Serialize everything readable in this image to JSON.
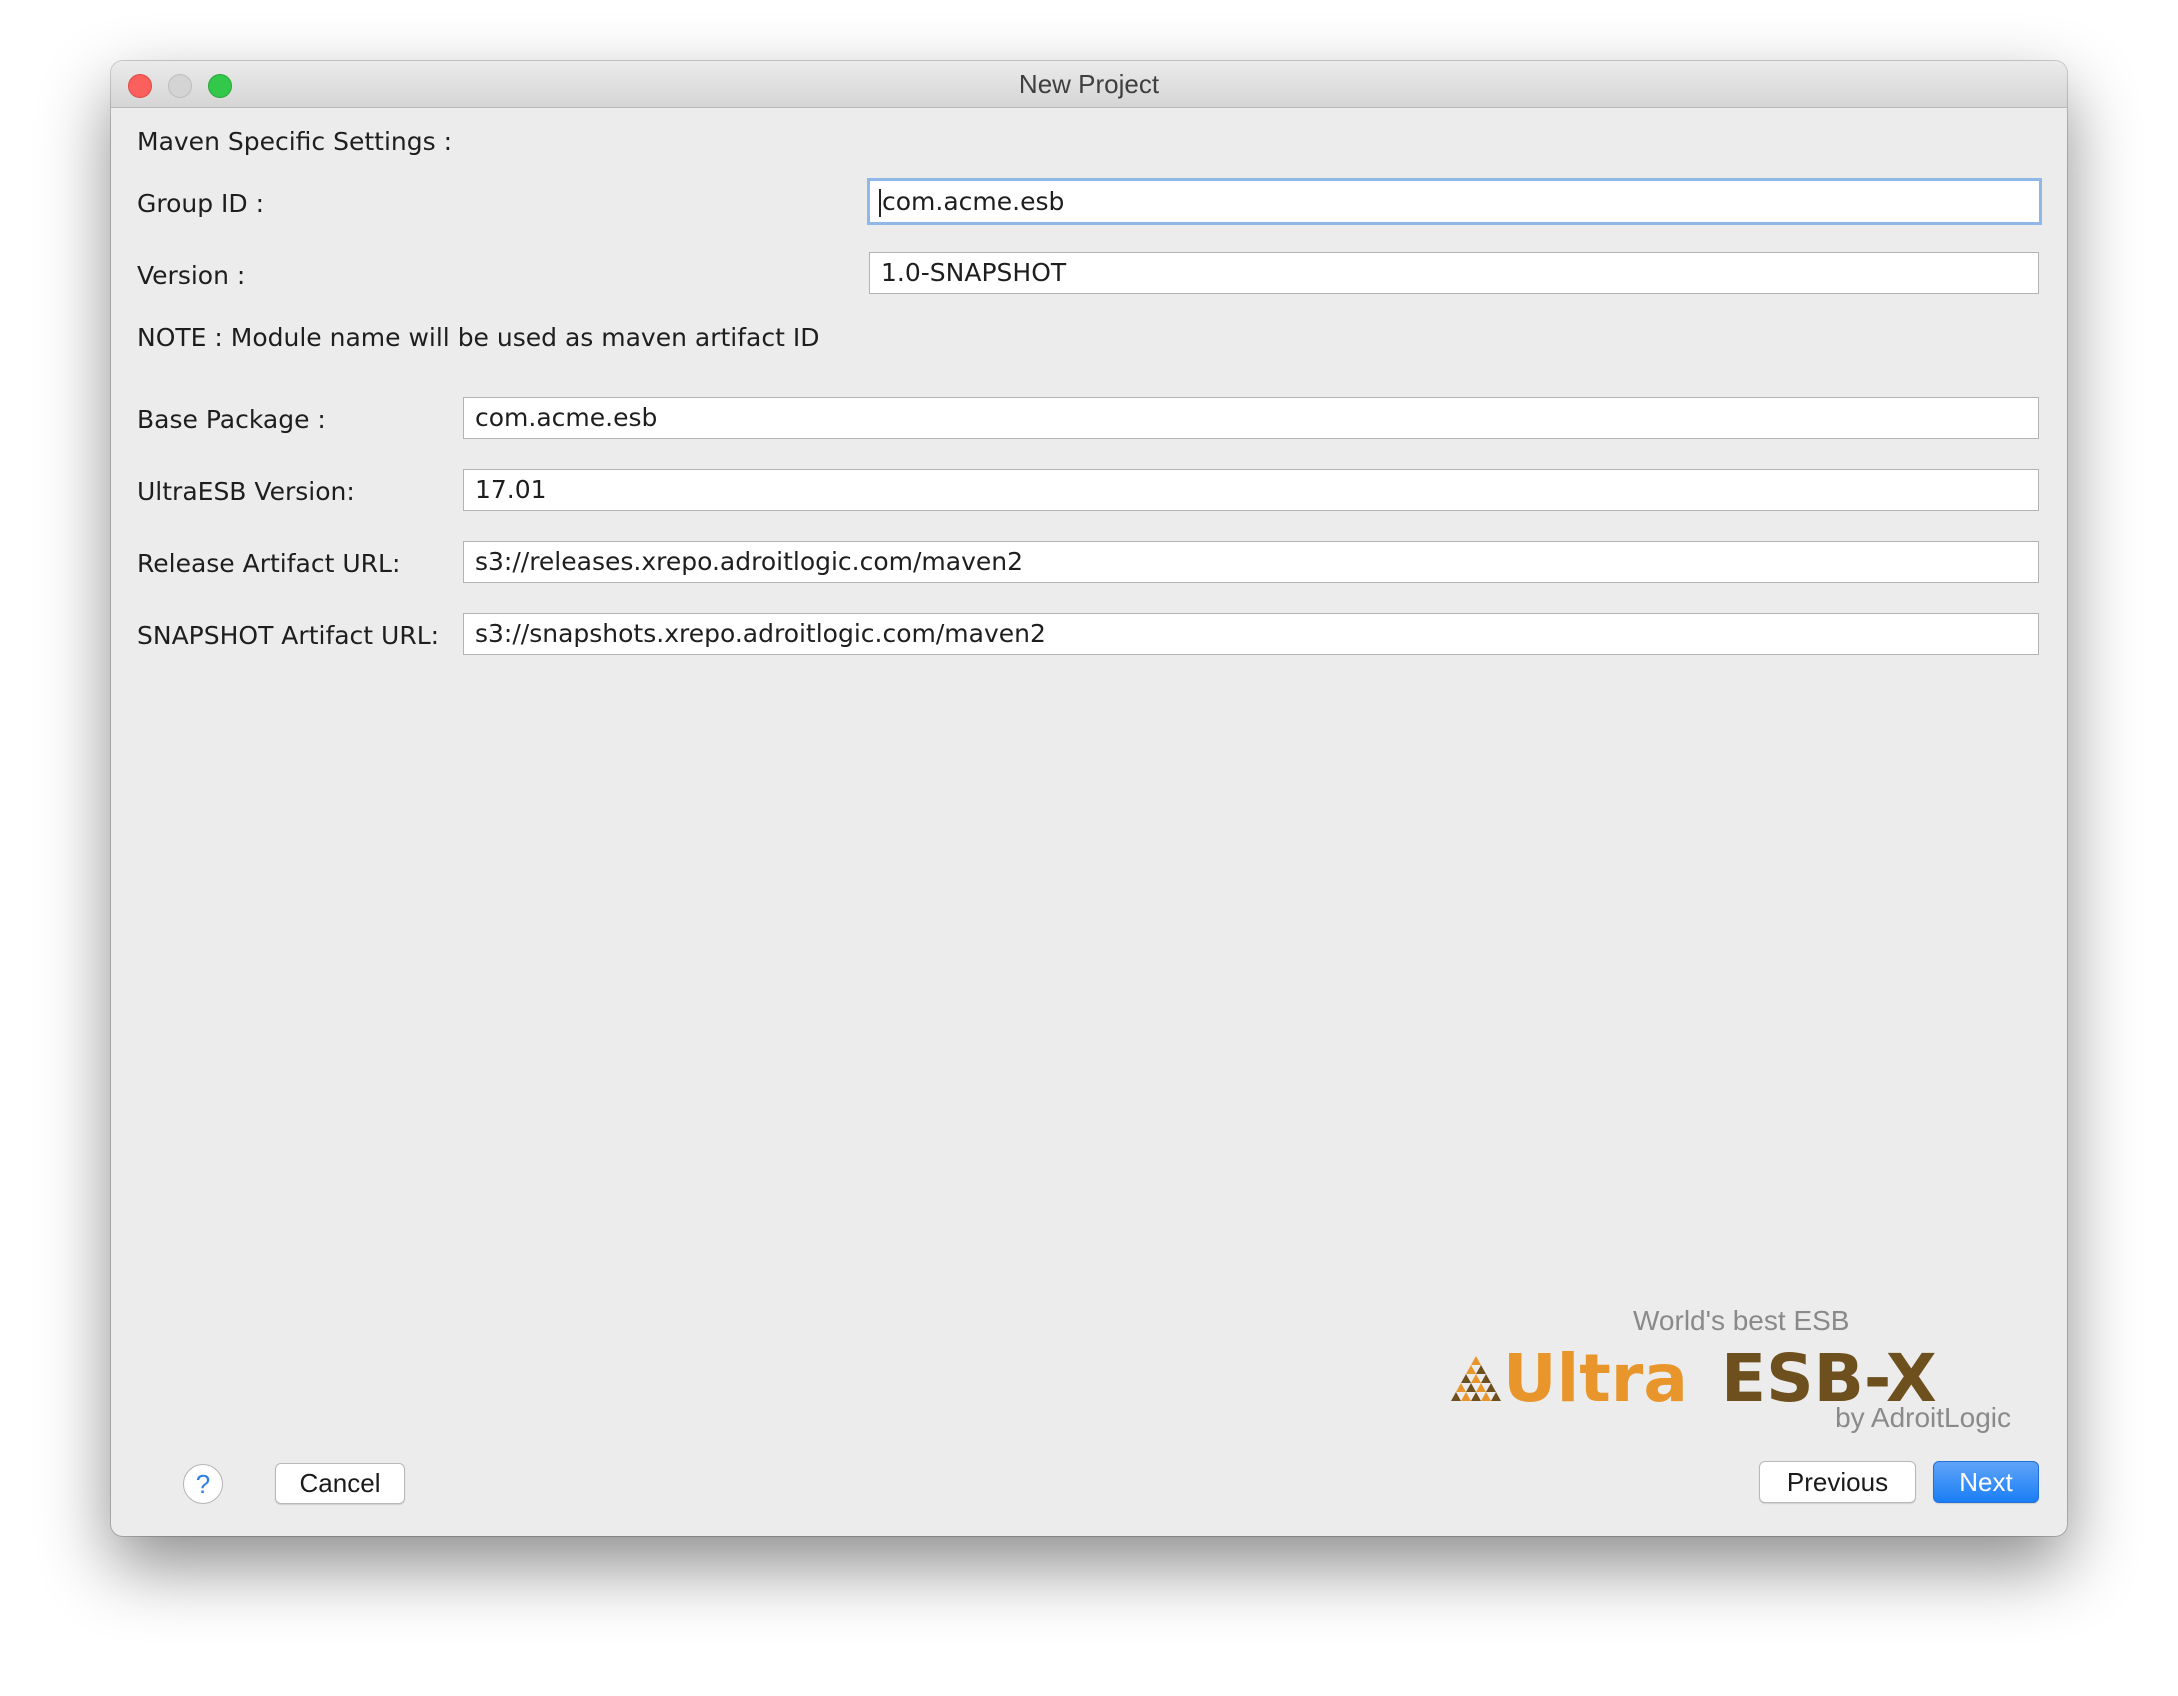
{
  "window": {
    "title": "New Project"
  },
  "form": {
    "section_heading": "Maven Specific Settings :",
    "group_id_label": "Group ID :",
    "group_id_value": "com.acme.esb",
    "version_label": "Version :",
    "version_value": "1.0-SNAPSHOT",
    "note": "NOTE : Module name will be used as maven artifact ID",
    "base_package_label": "Base Package :",
    "base_package_value": "com.acme.esb",
    "ultraesb_version_label": "UltraESB Version:",
    "ultraesb_version_value": "17.01",
    "release_url_label": "Release Artifact URL:",
    "release_url_value": "s3://releases.xrepo.adroitlogic.com/maven2",
    "snapshot_url_label": "SNAPSHOT Artifact URL:",
    "snapshot_url_value": "s3://snapshots.xrepo.adroitlogic.com/maven2"
  },
  "logo": {
    "tagline": "World's best ESB",
    "name_part1": "Ultra",
    "name_part2": "ESB-X",
    "byline": "by AdroitLogic",
    "colors": {
      "orange": "#e8962b",
      "brown": "#6e4f1e",
      "grey": "#8a8a8a"
    }
  },
  "footer": {
    "help_label": "?",
    "cancel_label": "Cancel",
    "previous_label": "Previous",
    "next_label": "Next"
  },
  "colors": {
    "accent": "#1a7ef5",
    "focus_ring": "#8fb7e8",
    "close": "#fc605c",
    "minimize": "#d4d4d4",
    "maximize": "#34c84a"
  }
}
